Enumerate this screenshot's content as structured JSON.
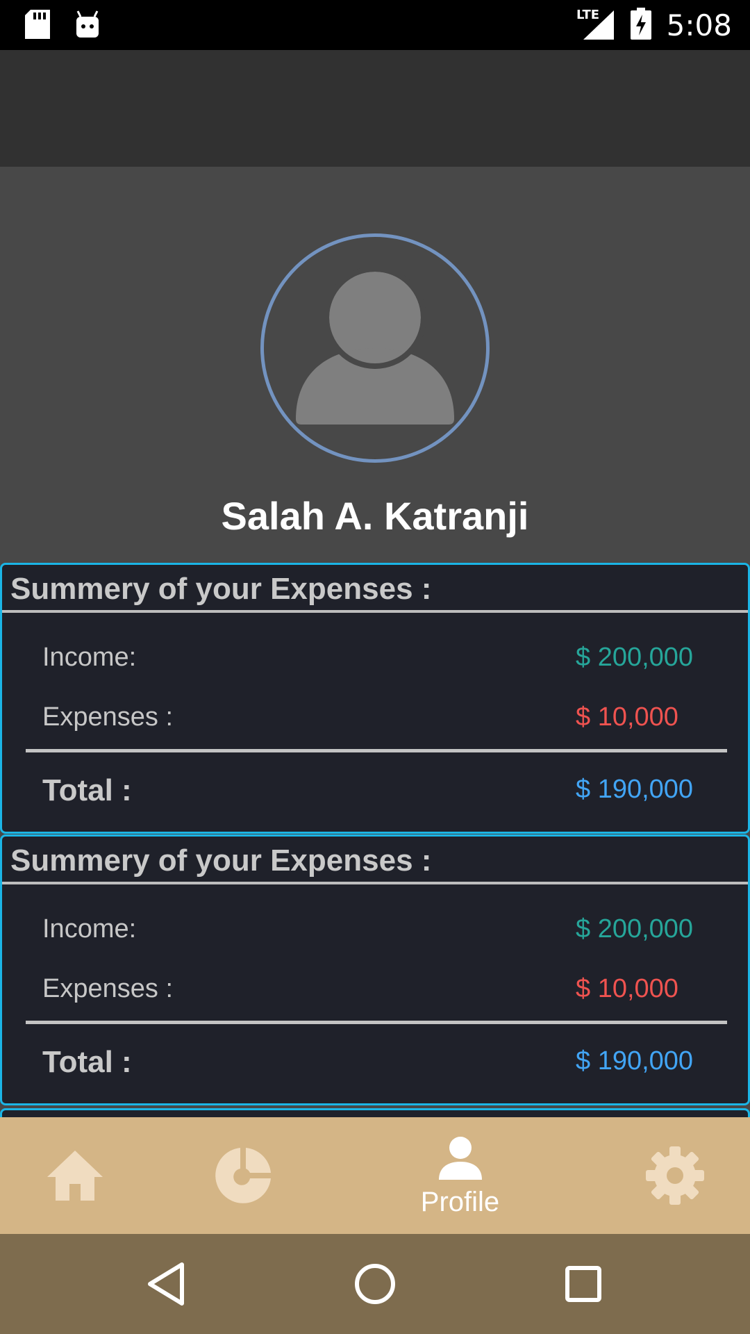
{
  "status_bar": {
    "time": "5:08",
    "network": "LTE",
    "icons": [
      "sd-card-icon",
      "android-debug-icon",
      "lte-signal-icon",
      "battery-charging-icon"
    ]
  },
  "profile": {
    "name": "Salah A. Katranji",
    "avatar_icon": "person-placeholder-icon"
  },
  "cards": [
    {
      "title": "Summery of your Expenses :",
      "income_label": "Income:",
      "income_value": "$ 200,000",
      "expenses_label": "Expenses :",
      "expenses_value": "$ 10,000",
      "total_label": "Total :",
      "total_value": "$ 190,000"
    },
    {
      "title": "Summery of your Expenses :",
      "income_label": "Income:",
      "income_value": "$ 200,000",
      "expenses_label": "Expenses :",
      "expenses_value": "$ 10,000",
      "total_label": "Total :",
      "total_value": "$ 190,000"
    }
  ],
  "colors": {
    "income": "#26a69a",
    "expenses": "#ef5350",
    "total": "#42a5f5",
    "card_border": "#1bb5e6",
    "bottom_nav": "#d4b586",
    "system_nav": "#7e6c4e"
  },
  "bottom_nav": {
    "items": [
      {
        "icon": "home-icon",
        "label": ""
      },
      {
        "icon": "pie-chart-icon",
        "label": ""
      },
      {
        "icon": "profile-icon",
        "label": "Profile",
        "active": true
      },
      {
        "icon": "settings-gear-icon",
        "label": ""
      }
    ]
  },
  "system_nav": {
    "icons": [
      "back-icon",
      "home-circle-icon",
      "recents-icon"
    ]
  }
}
